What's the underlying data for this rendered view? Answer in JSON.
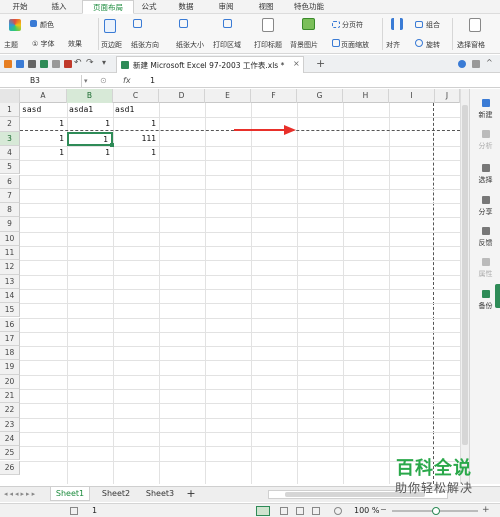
{
  "menu": {
    "tabs": [
      "开始",
      "插入",
      "页面布局",
      "公式",
      "数据",
      "审阅",
      "视图",
      "特色功能"
    ],
    "active_index": 2
  },
  "ribbon": {
    "theme": "主题",
    "colors": "颜色",
    "fonts": "字体",
    "effects": "效果",
    "margins": "页边距",
    "orientation": "纸张方向",
    "size": "纸张大小",
    "print_area": "打印区域",
    "print_titles": "打印标题",
    "background": "背景图片",
    "page_break": "分页符",
    "page_zoom": "页面缩放",
    "align": "对齐",
    "group": "组合",
    "rotate": "旋转",
    "selection_pane": "选择窗格"
  },
  "doc_tab": {
    "title": "新建 Microsoft Excel 97-2003 工作表.xls *"
  },
  "formula_bar": {
    "name_box": "B3",
    "fx": "fx",
    "value": "1"
  },
  "columns": [
    "A",
    "B",
    "C",
    "D",
    "E",
    "F",
    "G",
    "H",
    "I",
    "J"
  ],
  "selected_column": "B",
  "rows": [
    "1",
    "2",
    "3",
    "4",
    "5",
    "6",
    "7",
    "8",
    "9",
    "10",
    "11",
    "12",
    "13",
    "14",
    "15",
    "16",
    "17",
    "18",
    "19",
    "20",
    "21",
    "22",
    "23",
    "24",
    "25",
    "26"
  ],
  "selected_row": "3",
  "cells": {
    "a1": "sasd",
    "b1": "asda1",
    "c1": "asd1",
    "a2": "1",
    "b2": "1",
    "c2": "1",
    "a3": "1",
    "b3": "1",
    "c3": "111",
    "a4": "1",
    "b4": "1",
    "c4": "1"
  },
  "sidebar": {
    "items": [
      "新建",
      "分析",
      "选择",
      "分享",
      "反馈",
      "属性",
      "备份"
    ]
  },
  "sheets": {
    "tabs": [
      "Sheet1",
      "Sheet2",
      "Sheet3"
    ],
    "add": "+",
    "active_index": 0
  },
  "status": {
    "page": "1",
    "zoom": "100 %"
  },
  "watermark": {
    "line1": "百科全说",
    "line2": "助你轻松解决"
  },
  "colors": {
    "accent": "#1a8a3b",
    "arrow": "#e8302a",
    "selection": "#2e8b57"
  }
}
